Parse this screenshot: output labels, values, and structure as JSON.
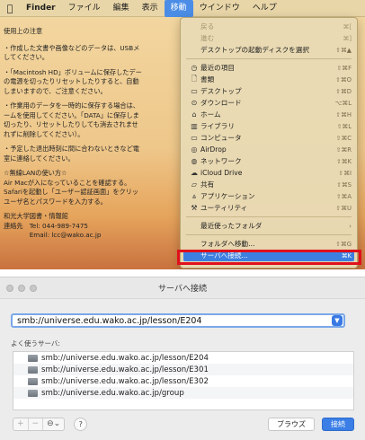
{
  "menubar": {
    "apple_icon": "apple-icon",
    "items": [
      "Finder",
      "ファイル",
      "編集",
      "表示",
      "移動",
      "ウインドウ",
      "ヘルプ"
    ],
    "active_index": 4
  },
  "document": {
    "title": "使用上の注意",
    "paragraphs": [
      [
        "・作成した文書や画像などのデータは、USBメ",
        "してください。"
      ],
      [
        "・「Macintosh HD」ボリュームに保存したデー",
        "の電源を切ったりリセットしたりすると、自動",
        "しまいますので、ご注意ください。"
      ],
      [
        "・作業用のデータを一時的に保存する場合は、",
        "ームを使用してください。「DATA」に保存しま",
        "切ったり、リセットしたりしても消去されませ",
        "れずに削除してください）。"
      ],
      [
        "・予定した退出時刻に間に合わないときなど電",
        "室に連絡してください。"
      ],
      [
        "☆無線LANの使い方☆",
        "Air Macが入になっていることを確認する。",
        "Safariを起動し「ユーザー認証画面」をクリッ",
        "ユーザ名とパスワードを入力する。"
      ],
      [
        "和光大学図書・情報館",
        "連絡先　Tel: 044-989-7475",
        "　　　　Email: lcc@wako.ac.jp"
      ]
    ]
  },
  "go_menu": {
    "items": [
      {
        "icon": "",
        "label": "戻る",
        "shortcut": "⌘[",
        "disabled": true
      },
      {
        "icon": "",
        "label": "進む",
        "shortcut": "⌘]",
        "disabled": true
      },
      {
        "icon": "",
        "label": "デスクトップの起動ディスクを選択",
        "shortcut": "⇧⌘▲",
        "disabled": false
      },
      {
        "sep": true
      },
      {
        "icon": "◷",
        "label": "最近の項目",
        "shortcut": "⇧⌘F",
        "disabled": false
      },
      {
        "icon": "🗋",
        "label": "書類",
        "shortcut": "⇧⌘O",
        "disabled": false
      },
      {
        "icon": "▭",
        "label": "デスクトップ",
        "shortcut": "⇧⌘D",
        "disabled": false
      },
      {
        "icon": "⊙",
        "label": "ダウンロード",
        "shortcut": "⌥⌘L",
        "disabled": false
      },
      {
        "icon": "⌂",
        "label": "ホーム",
        "shortcut": "⇧⌘H",
        "disabled": false
      },
      {
        "icon": "▥",
        "label": "ライブラリ",
        "shortcut": "⇧⌘L",
        "disabled": false
      },
      {
        "icon": "▭",
        "label": "コンピュータ",
        "shortcut": "⇧⌘C",
        "disabled": false
      },
      {
        "icon": "◎",
        "label": "AirDrop",
        "shortcut": "⇧⌘R",
        "disabled": false
      },
      {
        "icon": "◍",
        "label": "ネットワーク",
        "shortcut": "⇧⌘K",
        "disabled": false
      },
      {
        "icon": "☁",
        "label": "iCloud Drive",
        "shortcut": "⇧⌘I",
        "disabled": false
      },
      {
        "icon": "▱",
        "label": "共有",
        "shortcut": "⇧⌘S",
        "disabled": false
      },
      {
        "icon": "⩓",
        "label": "アプリケーション",
        "shortcut": "⇧⌘A",
        "disabled": false
      },
      {
        "icon": "⚒",
        "label": "ユーティリティ",
        "shortcut": "⇧⌘U",
        "disabled": false
      },
      {
        "sep": true
      },
      {
        "icon": "",
        "label": "最近使ったフォルダ",
        "shortcut": "›",
        "disabled": false
      },
      {
        "sep": true
      },
      {
        "icon": "",
        "label": "フォルダへ移動...",
        "shortcut": "⇧⌘G",
        "disabled": false
      },
      {
        "icon": "",
        "label": "サーバへ接続...",
        "shortcut": "⌘K",
        "disabled": false,
        "highlight": true
      }
    ]
  },
  "dialog": {
    "title": "サーバへ接続",
    "address_value": "smb://universe.edu.wako.ac.jp/lesson/E204",
    "favorites_label": "よく使うサーバ:",
    "servers": [
      "smb://universe.edu.wako.ac.jp/lesson/E204",
      "smb://universe.edu.wako.ac.jp/lesson/E301",
      "smb://universe.edu.wako.ac.jp/lesson/E302",
      "smb://universe.edu.wako.ac.jp/group"
    ],
    "seg_add": "+",
    "seg_remove": "−",
    "seg_more": "⊖⌄",
    "help_label": "?",
    "browse_label": "ブラウズ",
    "connect_label": "接続"
  }
}
